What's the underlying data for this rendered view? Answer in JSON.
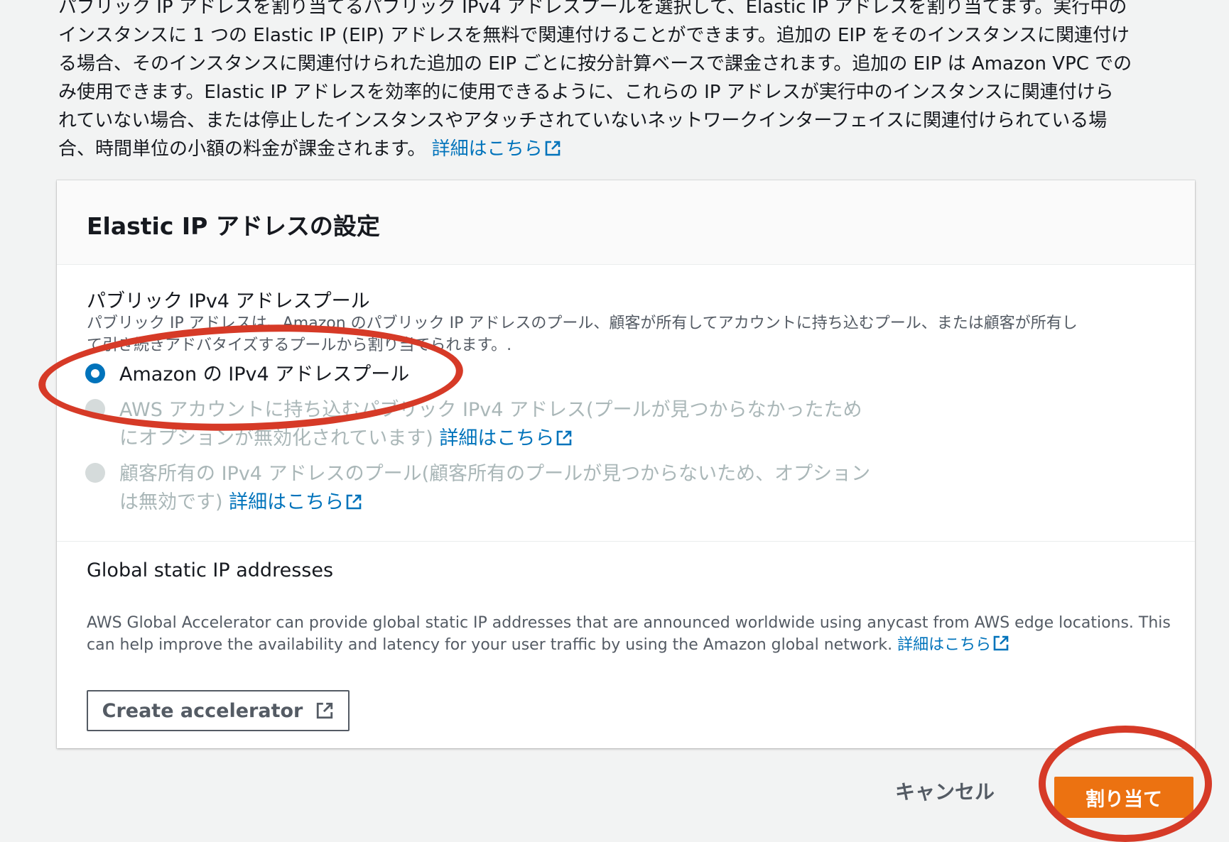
{
  "intro": {
    "lines": [
      "パブリック IP アドレスを割り当てるパブリック IPv4 アドレスプールを選択して、Elastic IP アドレスを割り当てます。実行中の",
      "インスタンスに 1 つの Elastic IP (EIP) アドレスを無料で関連付けることができます。追加の EIP をそのインスタンスに関連付け",
      "る場合、そのインスタンスに関連付けられた追加の EIP ごとに按分計算ベースで課金されます。追加の EIP は Amazon VPC での",
      "み使用できます。Elastic IP アドレスを効率的に使用できるように、これらの IP アドレスが実行中のインスタンスに関連付けら",
      "れていない場合、または停止したインスタンスやアタッチされていないネットワークインターフェイスに関連付けられている場",
      "合、時間単位の小額の料金が課金されます。"
    ],
    "learn_more": "詳細はこちら"
  },
  "card": {
    "title": "Elastic IP アドレスの設定",
    "pool": {
      "label": "パブリック IPv4 アドレスプール",
      "desc_lines": [
        "パブリック IP アドレスは、Amazon のパブリック IP アドレスのプール、顧客が所有してアカウントに持ち込むプール、または顧客が所有し",
        "て引き続きアドバタイズするプールから割り当てられます。."
      ],
      "options": [
        {
          "lines": [
            "Amazon の IPv4 アドレスプール"
          ],
          "checked": true,
          "disabled": false
        },
        {
          "lines": [
            "AWS アカウントに持ち込むパブリック IPv4 アドレス(プールが見つからなかったため",
            "にオプションが無効化されています)"
          ],
          "link": "詳細はこちら",
          "checked": false,
          "disabled": true
        },
        {
          "lines": [
            "顧客所有の IPv4 アドレスのプール(顧客所有のプールが見つからないため、オプション",
            "は無効です)"
          ],
          "link": "詳細はこちら",
          "checked": false,
          "disabled": true
        }
      ]
    },
    "global": {
      "label": "Global static IP addresses",
      "desc_lines": [
        "AWS Global Accelerator can provide global static IP addresses that are announced worldwide using anycast from AWS edge locations. This",
        "can help improve the availability and latency for your user traffic by using the Amazon global network."
      ],
      "learn_more": "詳細はこちら",
      "button_label": "Create accelerator"
    }
  },
  "footer": {
    "cancel_label": "キャンセル",
    "submit_label": "割り当て"
  },
  "colors": {
    "link": "#0073bb",
    "primary": "#ec7211",
    "annotation": "#d63a27"
  }
}
